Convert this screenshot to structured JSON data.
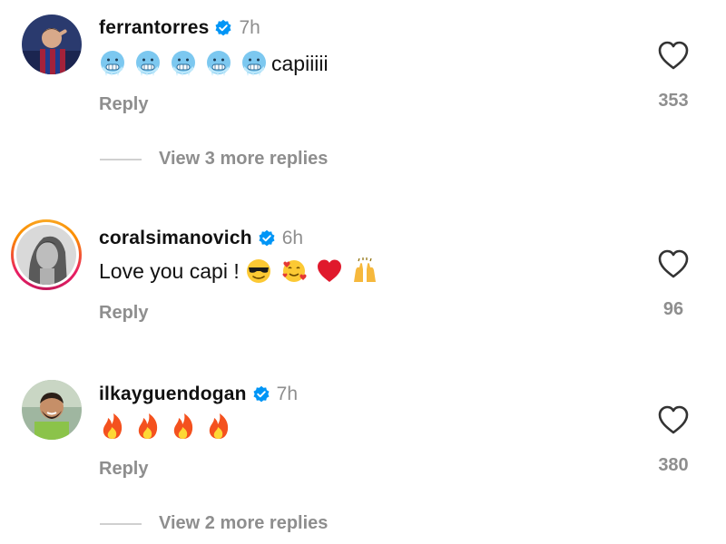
{
  "comments": [
    {
      "username": "ferrantorres",
      "verified": true,
      "time": "7h",
      "emojis": [
        "cold-face-emoji",
        "cold-face-emoji",
        "cold-face-emoji",
        "cold-face-emoji",
        "cold-face-emoji"
      ],
      "text": "capiiiii",
      "reply_label": "Reply",
      "likes": "353",
      "has_story_ring": false
    },
    {
      "username": "coralsimanovich",
      "verified": true,
      "time": "6h",
      "text": "Love you capi !",
      "emojis": [
        "sunglasses-emoji",
        "smiling-face-with-hearts-emoji",
        "red-heart-emoji",
        "raising-hands-emoji"
      ],
      "reply_label": "Reply",
      "likes": "96",
      "has_story_ring": true
    },
    {
      "username": "ilkayguendogan",
      "verified": true,
      "time": "7h",
      "emojis": [
        "fire-emoji",
        "fire-emoji",
        "fire-emoji",
        "fire-emoji"
      ],
      "text": "",
      "reply_label": "Reply",
      "likes": "380",
      "has_story_ring": false
    }
  ],
  "view_replies": [
    {
      "label": "View 3 more replies"
    },
    {
      "label": "View 2 more replies"
    }
  ],
  "colors": {
    "text": "#111111",
    "secondary": "#8e8e8e",
    "verified_blue": "#0095f6",
    "divider": "#d0d0d0"
  }
}
